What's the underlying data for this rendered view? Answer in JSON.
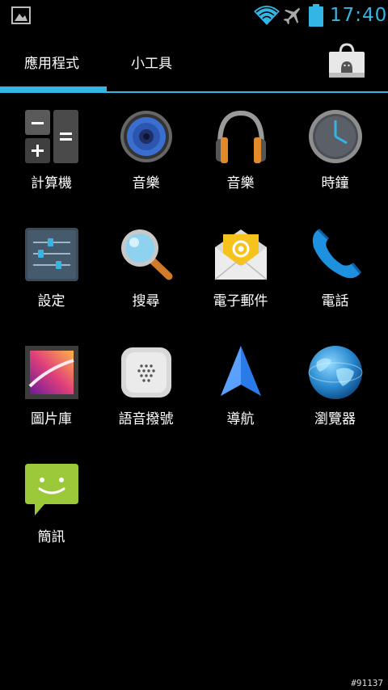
{
  "status_bar": {
    "time": "17:40",
    "icons": [
      "gallery-notification-icon",
      "wifi-icon",
      "airplane-icon",
      "battery-icon"
    ],
    "accent_color": "#33b5e5"
  },
  "tabs": [
    {
      "label": "應用程式",
      "selected": true
    },
    {
      "label": "小工具",
      "selected": false
    }
  ],
  "store_icon": "play-store-bag-icon",
  "apps": [
    {
      "label": "計算機",
      "icon": "calculator-icon"
    },
    {
      "label": "音樂",
      "icon": "speaker-icon"
    },
    {
      "label": "音樂",
      "icon": "headphones-icon"
    },
    {
      "label": "時鐘",
      "icon": "clock-icon"
    },
    {
      "label": "設定",
      "icon": "settings-sliders-icon"
    },
    {
      "label": "搜尋",
      "icon": "magnifier-icon"
    },
    {
      "label": "電子郵件",
      "icon": "email-envelope-icon"
    },
    {
      "label": "電話",
      "icon": "phone-handset-icon"
    },
    {
      "label": "圖片庫",
      "icon": "gallery-icon"
    },
    {
      "label": "語音撥號",
      "icon": "voice-dialer-icon"
    },
    {
      "label": "導航",
      "icon": "navigation-arrow-icon"
    },
    {
      "label": "瀏覽器",
      "icon": "browser-globe-icon"
    },
    {
      "label": "簡訊",
      "icon": "messaging-bubble-icon"
    }
  ],
  "watermark": "#91137"
}
